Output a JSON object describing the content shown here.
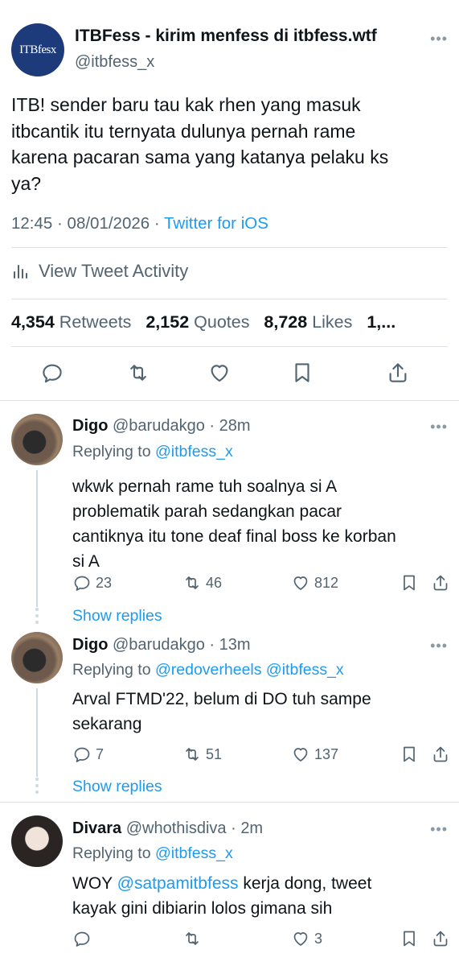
{
  "main": {
    "avatar_text": "ITBfesx",
    "name": "ITBFess - kirim menfess di itbfess.wtf",
    "handle": "@itbfess_x",
    "more": "•••",
    "text_lines": [
      "ITB! sender baru tau kak rhen yang masuk",
      "itbcantik itu ternyata dulunya pernah rame",
      "karena pacaran sama yang katanya pelaku ks",
      "ya?"
    ],
    "time": "12:45",
    "date": "08/01/2026",
    "source": "Twitter for iOS",
    "activity_label": "View Tweet Activity",
    "stats": {
      "retweets": "4,354",
      "retweets_label": "Retweets",
      "quotes": "2,152",
      "quotes_label": "Quotes",
      "likes": "8,728",
      "likes_label": "Likes",
      "more": "1,..."
    }
  },
  "replies": [
    {
      "name": "Digo",
      "handle": "@barudakgo",
      "time": "28m",
      "replying_label": "Replying to",
      "replying_to": "@itbfess_x",
      "text_lines": [
        "wkwk pernah rame tuh soalnya si A",
        "problematik parah sedangkan pacar",
        "cantiknya itu tone deaf final boss ke korban",
        "si A"
      ],
      "replies": "23",
      "retweets": "46",
      "likes": "812",
      "show_replies": "Show replies"
    },
    {
      "name": "Digo",
      "handle": "@barudakgo",
      "time": "13m",
      "replying_label": "Replying to",
      "replying_to": "@redoverheels @itbfess_x",
      "text_lines": [
        "Arval FTMD'22, belum di DO tuh sampe",
        "sekarang"
      ],
      "replies": "7",
      "retweets": "51",
      "likes": "137",
      "show_replies": "Show replies"
    },
    {
      "name": "Divara",
      "handle": "@whothisdiva",
      "time": "2m",
      "replying_label": "Replying to",
      "replying_to": "@itbfess_x",
      "text_pre": "WOY ",
      "text_mention": "@satpamitbfess",
      "text_post": " kerja dong, tweet",
      "text_line2": "kayak gini dibiarin lolos gimana sih",
      "replies": "",
      "retweets": "",
      "likes": "3"
    }
  ],
  "icons": {
    "reply": "comment-icon",
    "retweet": "retweet-icon",
    "like": "heart-icon",
    "bookmark": "bookmark-icon",
    "share": "share-icon",
    "activity": "bar-chart-icon"
  },
  "colors": {
    "link": "#1d9bf0",
    "muted": "#536471",
    "text": "#0f1419",
    "divider": "#dfe3e8"
  }
}
